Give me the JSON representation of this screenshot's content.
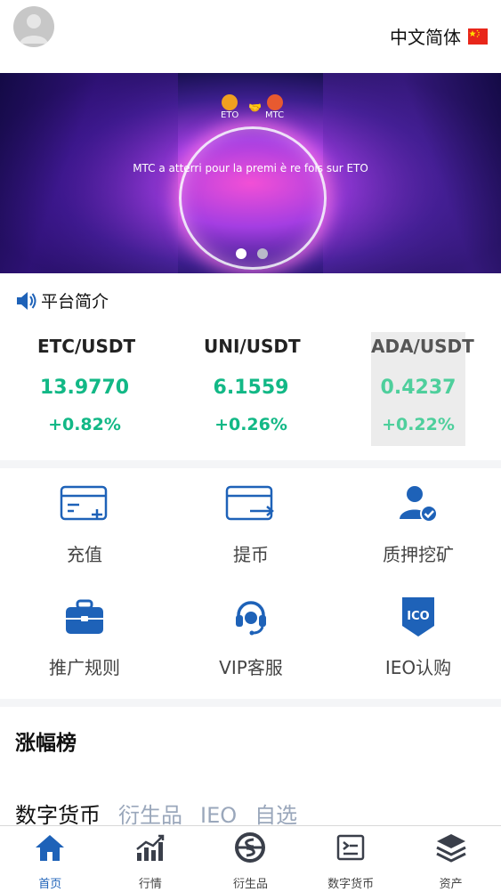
{
  "header": {
    "language_label": "中文简体"
  },
  "banner": {
    "logo_left": "ETO",
    "logo_right": "MTC",
    "headline": "MTC a atterri pour la premi è re fois sur ETO"
  },
  "intro": {
    "label": "平台简介"
  },
  "tickers": [
    {
      "pair": "ETC/USDT",
      "price": "13.9770",
      "change": "+0.82%"
    },
    {
      "pair": "UNI/USDT",
      "price": "6.1559",
      "change": "+0.26%"
    },
    {
      "pair": "ADA/USDT",
      "price": "0.4237",
      "change": "+0.22%"
    }
  ],
  "actions": [
    {
      "label": "充值",
      "icon": "recharge-card-icon"
    },
    {
      "label": "提币",
      "icon": "withdraw-card-icon"
    },
    {
      "label": "质押挖矿",
      "icon": "staking-user-icon"
    },
    {
      "label": "推广规则",
      "icon": "briefcase-icon"
    },
    {
      "label": "VIP客服",
      "icon": "headset-icon"
    },
    {
      "label": "IEO认购",
      "icon": "ico-badge-icon"
    }
  ],
  "ranking": {
    "title": "涨幅榜",
    "tabs": [
      "数字货币",
      "衍生品",
      "IEO",
      "自选"
    ],
    "active_tab": "数字货币"
  },
  "bottom_nav": [
    {
      "label": "首页",
      "icon": "home-icon"
    },
    {
      "label": "行情",
      "icon": "market-chart-icon"
    },
    {
      "label": "衍生品",
      "icon": "derivatives-icon"
    },
    {
      "label": "数字货币",
      "icon": "digital-currency-icon"
    },
    {
      "label": "资产",
      "icon": "assets-layers-icon"
    }
  ],
  "colors": {
    "accent": "#1e62b8",
    "up": "#12b886",
    "tab_inactive": "#9aa7bb"
  }
}
